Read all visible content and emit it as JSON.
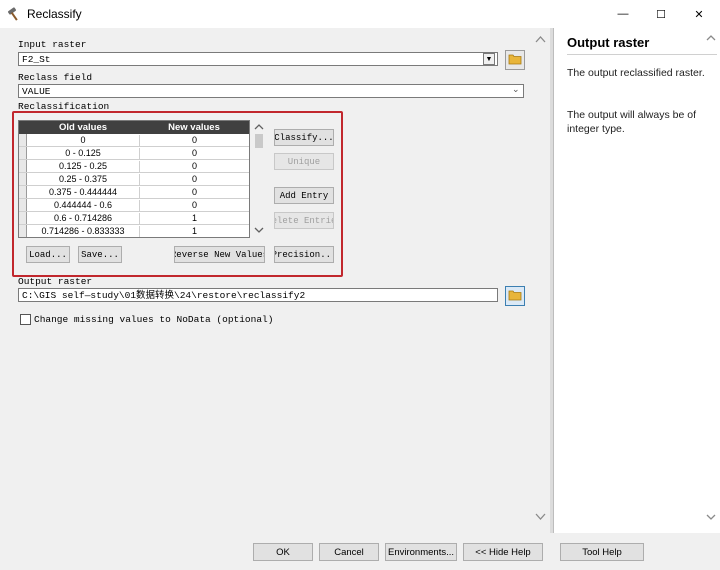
{
  "window": {
    "title": "Reclassify",
    "controls": {
      "minimize": "—",
      "maximize": "☐",
      "close": "✕"
    }
  },
  "input_raster": {
    "label": "Input raster",
    "value": "F2_St"
  },
  "reclass_field": {
    "label": "Reclass field",
    "value": "VALUE"
  },
  "reclassification": {
    "label": "Reclassification",
    "columns": [
      "Old values",
      "New values"
    ],
    "rows": [
      {
        "old": "0",
        "new": "0"
      },
      {
        "old": "0 - 0.125",
        "new": "0"
      },
      {
        "old": "0.125 - 0.25",
        "new": "0"
      },
      {
        "old": "0.25 - 0.375",
        "new": "0"
      },
      {
        "old": "0.375 - 0.444444",
        "new": "0"
      },
      {
        "old": "0.444444 - 0.6",
        "new": "0"
      },
      {
        "old": "0.6 - 0.714286",
        "new": "1"
      },
      {
        "old": "0.714286 - 0.833333",
        "new": "1"
      }
    ],
    "buttons": {
      "classify": "Classify...",
      "unique": "Unique",
      "add_entry": "Add Entry",
      "delete_entries": "elete Entrie",
      "load": "Load...",
      "save": "Save...",
      "reverse": "Reverse New Values",
      "precision": "Precision..."
    }
  },
  "output_raster": {
    "label": "Output raster",
    "value": "C:\\GIS  self—study\\01数据转换\\24\\restore\\reclassify2"
  },
  "missing_values": {
    "label": "Change missing values to NoData (optional)"
  },
  "help": {
    "title": "Output raster",
    "paragraphs": [
      "The output reclassified raster.",
      "The output will always be of integer type."
    ]
  },
  "footer": {
    "ok": "OK",
    "cancel": "Cancel",
    "environments": "Environments...",
    "hide_help": "<< Hide Help",
    "tool_help": "Tool Help"
  },
  "colors": {
    "highlight_border": "#c1272d",
    "header_bg": "#404040"
  }
}
